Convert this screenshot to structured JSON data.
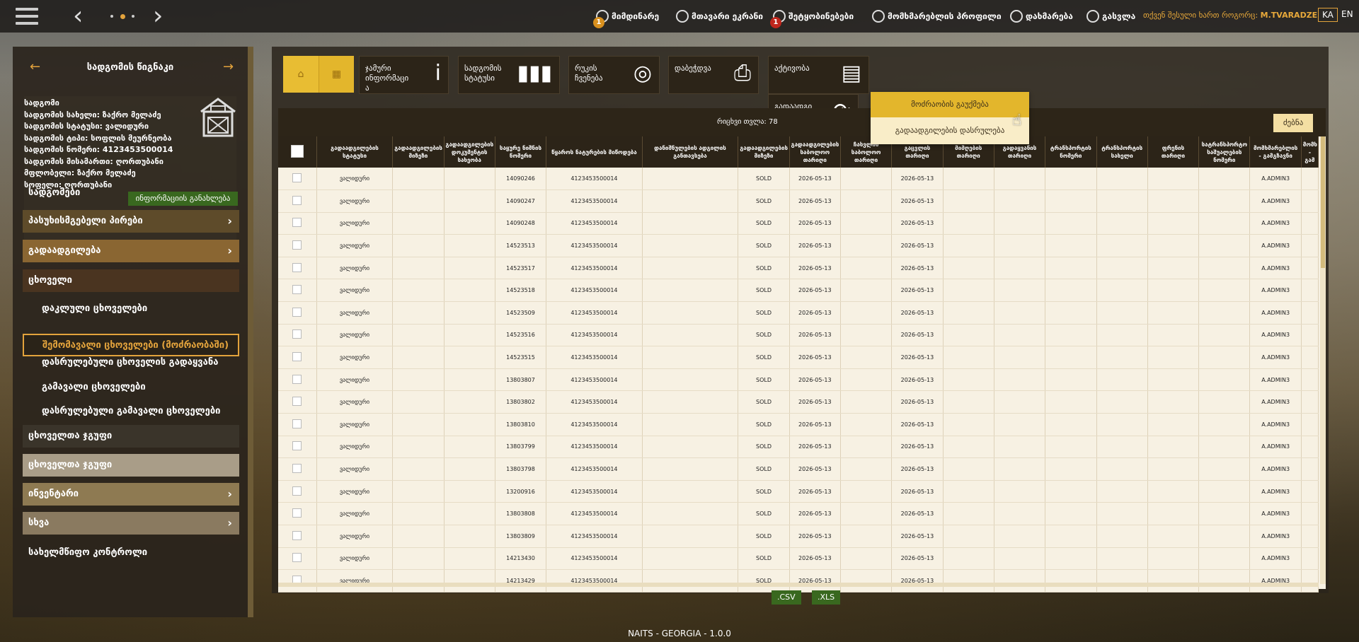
{
  "topbar": {
    "items": [
      {
        "label": "მიმდინარე",
        "badge": "1",
        "badge_color": "#d8901e"
      },
      {
        "label": "მთავარი ეკრანი"
      },
      {
        "label": "შეტყობინებები",
        "badge": "1",
        "badge_color": "#c0261c"
      },
      {
        "label": "მომხმარებლის პროფილი"
      },
      {
        "label": "დახმარება"
      },
      {
        "label": "გასვლა"
      }
    ],
    "user_prefix": "თქვენ შესული ხართ როგორც:",
    "user_name": "M.TVARADZE",
    "lang_ka": "KA",
    "lang_en": "EN"
  },
  "sidebar": {
    "title": "სადგომის წიგნაკი",
    "holding_lines": [
      "სადგომი",
      "სადგომის სახელი: ზაქრო მელაძე",
      "სადგომის სტატუსი: ვალიდური",
      "სადგომის ტიპი: სოფლის მეურნეობა",
      "სადგომის ნომერი: 4123453500014",
      "სადგომის მისამართი: ღორთუბანი",
      "მფლობელი: ზაქრო მელაძე",
      "სოფელი: ღორთუბანი"
    ],
    "info_button": "ინფორმაციის განახლება",
    "menu": [
      {
        "label": "სადგომები"
      },
      {
        "label": "პასუხისმგებელი პირები",
        "chevron": "›"
      },
      {
        "label": "გადაადგილება",
        "chevron": "›"
      },
      {
        "label": "ცხოველი"
      },
      {
        "label": "ცხოველთა ჯგუფი"
      },
      {
        "label": "ცხოველთა ჯგუფი"
      },
      {
        "label": "ინვენტარი",
        "chevron": "›"
      },
      {
        "label": "სხვა",
        "chevron": "›"
      },
      {
        "label": "სახელმწიფო კონტროლი"
      }
    ],
    "submenu": [
      "დაკლული ცხოველები",
      "შემომავალი ცხოველები (მოძრაობაში)",
      "დასრულებული ცხოველის გადაყვანა",
      "გამავალი ცხოველები",
      "დასრულებული გამავალი ცხოველები"
    ]
  },
  "toolbar": {
    "buttons": [
      {
        "label": "ჯამური\nინფორმაცი\nა",
        "icon": "info-icon",
        "glyph": "i"
      },
      {
        "label": "სადგომის\nსტატუსი",
        "icon": "bar-chart-icon",
        "glyph": "▮▮▮"
      },
      {
        "label": "რუკის\nჩვენება",
        "icon": "globe-icon",
        "glyph": "◎"
      },
      {
        "label": "დაბეჭდვა",
        "icon": "printer-icon",
        "glyph": "⎙"
      },
      {
        "label": "აქტივობა",
        "icon": "clipboard-icon",
        "glyph": "▤"
      },
      {
        "label": "გადაადგი\nლების\nისტორია",
        "icon": "refresh-icon",
        "glyph": "⟳"
      }
    ]
  },
  "grid": {
    "count_label": "რიცხვი თვლა: 78",
    "search_button": "ძებნა",
    "columns": [
      "",
      "გადაადგილების სტატუსი",
      "გადაადგილების მიზეზი",
      "გადაადგილების დოკუმენტის სახეობა",
      "საყურე ნიშნის ნომერი",
      "წყაროს ნატურების მიწოდება",
      "დანიშნულების ადგილის განთავსება",
      "გადაადგილების მიზეზი",
      "გადაადგილების საბოლოო თარიღი",
      "ჩასვლის საბოლოო თარიღი",
      "გაცვლის თარიღი",
      "მიმღების თარიღი",
      "გადაყვანის თარიღი",
      "ტრანსპორტის ნომერი",
      "ტრანსპორტის სახელი",
      "ფრენის თარიღი",
      "სატრანსპორტო საშუალების ნომერი",
      "მომხმარებლის - გამგზავნი",
      "მომხ - გამ"
    ],
    "rows": [
      [
        "ვალიდური",
        "",
        "",
        "14090246",
        "4123453500014",
        "",
        "SOLD",
        "2026-05-13",
        "",
        "2026-05-13",
        "",
        "",
        "",
        "",
        "",
        "",
        "A.ADMIN3",
        ""
      ],
      [
        "ვალიდური",
        "",
        "",
        "14090247",
        "4123453500014",
        "",
        "SOLD",
        "2026-05-13",
        "",
        "2026-05-13",
        "",
        "",
        "",
        "",
        "",
        "",
        "A.ADMIN3",
        ""
      ],
      [
        "ვალიდური",
        "",
        "",
        "14090248",
        "4123453500014",
        "",
        "SOLD",
        "2026-05-13",
        "",
        "2026-05-13",
        "",
        "",
        "",
        "",
        "",
        "",
        "A.ADMIN3",
        ""
      ],
      [
        "ვალიდური",
        "",
        "",
        "14523513",
        "4123453500014",
        "",
        "SOLD",
        "2026-05-13",
        "",
        "2026-05-13",
        "",
        "",
        "",
        "",
        "",
        "",
        "A.ADMIN3",
        ""
      ],
      [
        "ვალიდური",
        "",
        "",
        "14523517",
        "4123453500014",
        "",
        "SOLD",
        "2026-05-13",
        "",
        "2026-05-13",
        "",
        "",
        "",
        "",
        "",
        "",
        "A.ADMIN3",
        ""
      ],
      [
        "ვალიდური",
        "",
        "",
        "14523518",
        "4123453500014",
        "",
        "SOLD",
        "2026-05-13",
        "",
        "2026-05-13",
        "",
        "",
        "",
        "",
        "",
        "",
        "A.ADMIN3",
        ""
      ],
      [
        "ვალიდური",
        "",
        "",
        "14523509",
        "4123453500014",
        "",
        "SOLD",
        "2026-05-13",
        "",
        "2026-05-13",
        "",
        "",
        "",
        "",
        "",
        "",
        "A.ADMIN3",
        ""
      ],
      [
        "ვალიდური",
        "",
        "",
        "14523516",
        "4123453500014",
        "",
        "SOLD",
        "2026-05-13",
        "",
        "2026-05-13",
        "",
        "",
        "",
        "",
        "",
        "",
        "A.ADMIN3",
        ""
      ],
      [
        "ვალიდური",
        "",
        "",
        "14523515",
        "4123453500014",
        "",
        "SOLD",
        "2026-05-13",
        "",
        "2026-05-13",
        "",
        "",
        "",
        "",
        "",
        "",
        "A.ADMIN3",
        ""
      ],
      [
        "ვალიდური",
        "",
        "",
        "13803807",
        "4123453500014",
        "",
        "SOLD",
        "2026-05-13",
        "",
        "2026-05-13",
        "",
        "",
        "",
        "",
        "",
        "",
        "A.ADMIN3",
        ""
      ],
      [
        "ვალიდური",
        "",
        "",
        "13803802",
        "4123453500014",
        "",
        "SOLD",
        "2026-05-13",
        "",
        "2026-05-13",
        "",
        "",
        "",
        "",
        "",
        "",
        "A.ADMIN3",
        ""
      ],
      [
        "ვალიდური",
        "",
        "",
        "13803810",
        "4123453500014",
        "",
        "SOLD",
        "2026-05-13",
        "",
        "2026-05-13",
        "",
        "",
        "",
        "",
        "",
        "",
        "A.ADMIN3",
        ""
      ],
      [
        "ვალიდური",
        "",
        "",
        "13803799",
        "4123453500014",
        "",
        "SOLD",
        "2026-05-13",
        "",
        "2026-05-13",
        "",
        "",
        "",
        "",
        "",
        "",
        "A.ADMIN3",
        ""
      ],
      [
        "ვალიდური",
        "",
        "",
        "13803798",
        "4123453500014",
        "",
        "SOLD",
        "2026-05-13",
        "",
        "2026-05-13",
        "",
        "",
        "",
        "",
        "",
        "",
        "A.ADMIN3",
        ""
      ],
      [
        "ვალიდური",
        "",
        "",
        "13200916",
        "4123453500014",
        "",
        "SOLD",
        "2026-05-13",
        "",
        "2026-05-13",
        "",
        "",
        "",
        "",
        "",
        "",
        "A.ADMIN3",
        ""
      ],
      [
        "ვალიდური",
        "",
        "",
        "13803808",
        "4123453500014",
        "",
        "SOLD",
        "2026-05-13",
        "",
        "2026-05-13",
        "",
        "",
        "",
        "",
        "",
        "",
        "A.ADMIN3",
        ""
      ],
      [
        "ვალიდური",
        "",
        "",
        "13803809",
        "4123453500014",
        "",
        "SOLD",
        "2026-05-13",
        "",
        "2026-05-13",
        "",
        "",
        "",
        "",
        "",
        "",
        "A.ADMIN3",
        ""
      ],
      [
        "ვალიდური",
        "",
        "",
        "14213430",
        "4123453500014",
        "",
        "SOLD",
        "2026-05-13",
        "",
        "2026-05-13",
        "",
        "",
        "",
        "",
        "",
        "",
        "A.ADMIN3",
        ""
      ],
      [
        "ვალიდური",
        "",
        "",
        "14213429",
        "4123453500014",
        "",
        "SOLD",
        "2026-05-13",
        "",
        "2026-05-13",
        "",
        "",
        "",
        "",
        "",
        "",
        "A.ADMIN3",
        ""
      ]
    ]
  },
  "dropdown": {
    "item1": "მოძრაობის გაუქმება",
    "item2": "გადაადგილების დასრულება"
  },
  "export": {
    "csv": ".CSV",
    "xls": ".XLS"
  },
  "footer": "NAITS - GEORGIA - 1.0.0",
  "colors": {
    "accent": "#e3a33c",
    "primary_yellow": "#e3b62c",
    "green": "#39681f",
    "panel": "#2a241c"
  }
}
